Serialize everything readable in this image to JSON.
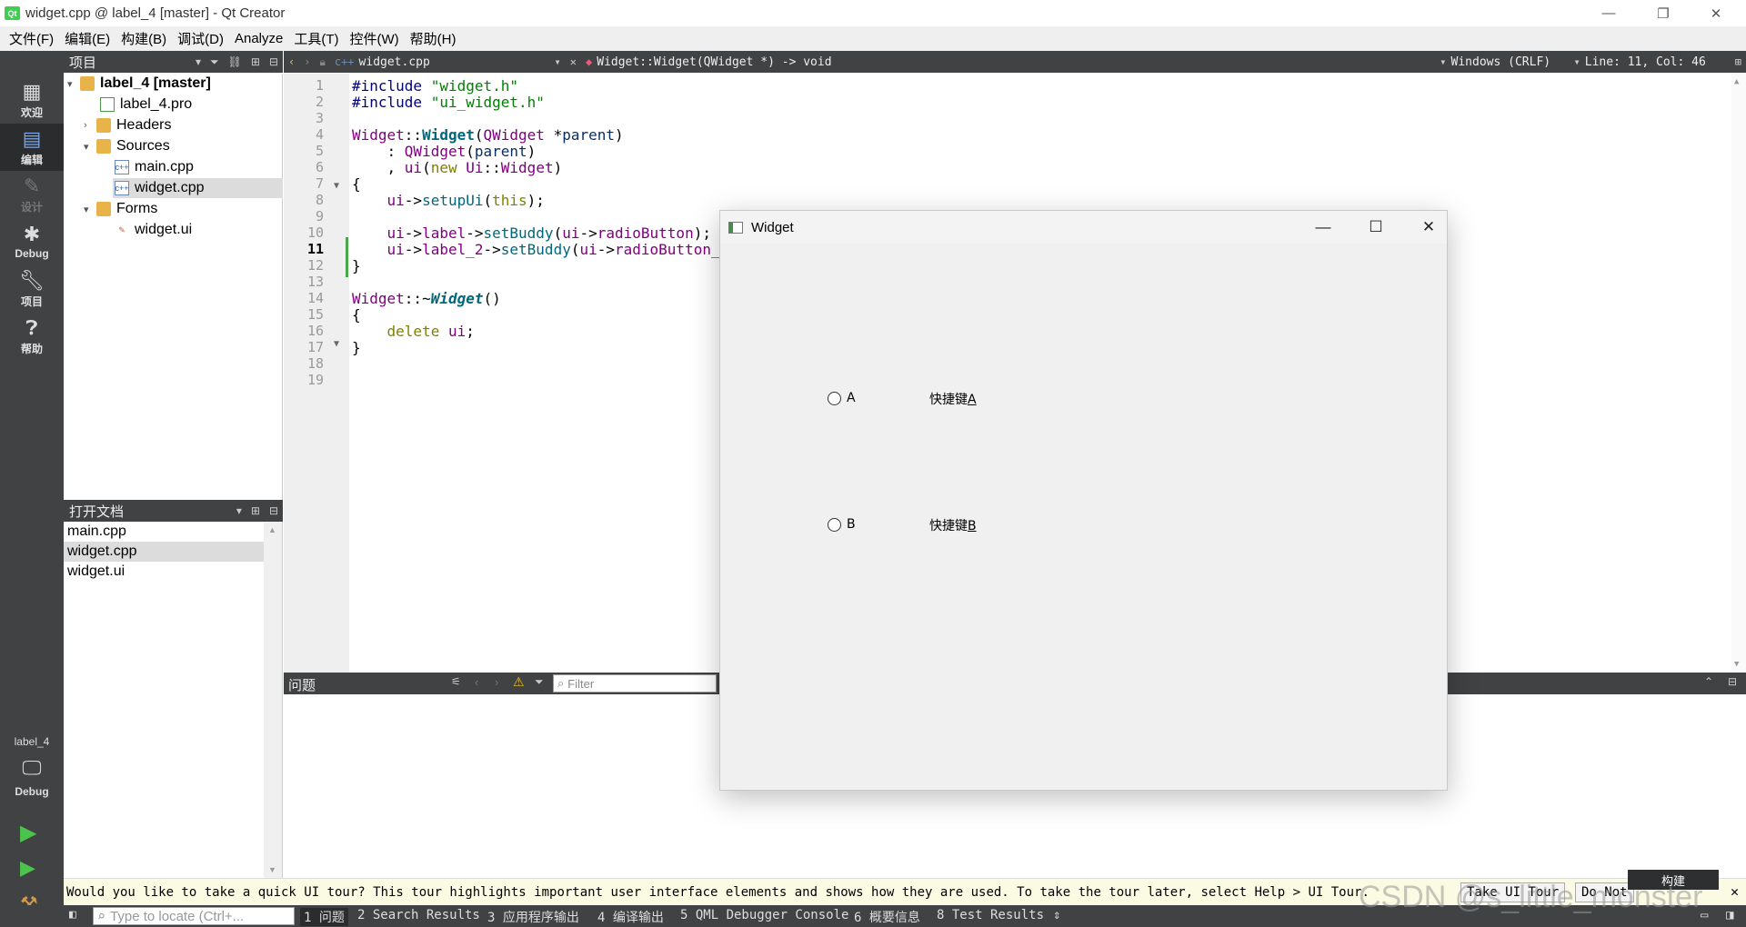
{
  "window": {
    "title": "widget.cpp @ label_4 [master] - Qt Creator"
  },
  "menu": [
    "文件(F)",
    "编辑(E)",
    "构建(B)",
    "调试(D)",
    "Analyze",
    "工具(T)",
    "控件(W)",
    "帮助(H)"
  ],
  "modes": [
    {
      "label": "欢迎",
      "icon": "grid-icon"
    },
    {
      "label": "编辑",
      "icon": "edit-icon"
    },
    {
      "label": "设计",
      "icon": "pencil-icon"
    },
    {
      "label": "Debug",
      "icon": "bug-icon"
    },
    {
      "label": "项目",
      "icon": "wrench-icon"
    },
    {
      "label": "帮助",
      "icon": "help-icon"
    }
  ],
  "kit": {
    "project": "label_4",
    "config": "Debug"
  },
  "project_pane": {
    "title": "项目",
    "tree": [
      {
        "label": "label_4 [master]"
      },
      {
        "label": "label_4.pro"
      },
      {
        "label": "Headers"
      },
      {
        "label": "Sources"
      },
      {
        "label": "main.cpp"
      },
      {
        "label": "widget.cpp"
      },
      {
        "label": "Forms"
      },
      {
        "label": "widget.ui"
      }
    ]
  },
  "open_docs": {
    "title": "打开文档",
    "items": [
      "main.cpp",
      "widget.cpp",
      "widget.ui"
    ]
  },
  "editor_bar": {
    "file": "widget.cpp",
    "symbol": "Widget::Widget(QWidget *) -> void",
    "encoding": "Windows (CRLF)",
    "position": "Line: 11, Col: 46"
  },
  "line_numbers": [
    "1",
    "2",
    "3",
    "4",
    "5",
    "6",
    "7",
    "8",
    "9",
    "10",
    "11",
    "12",
    "13",
    "14",
    "15",
    "16",
    "17",
    "18",
    "19"
  ],
  "issues": {
    "title": "问题",
    "filter_placeholder": "Filter"
  },
  "tour": {
    "message": "Would you like to take a quick UI tour? This tour highlights important user interface elements and shows how they are used. To take the tour later, select Help > UI Tour.",
    "take_button": "Take UI Tour",
    "dismiss_button": "Do Not"
  },
  "status": {
    "locator_placeholder": "Type to locate (Ctrl+...",
    "tabs": [
      "1 问题",
      "2 Search Results",
      "3 应用程序输出",
      "4 编译输出",
      "5 QML Debugger Console",
      "6 概要信息",
      "8 Test Results"
    ]
  },
  "build_tooltip": "构建",
  "widget_window": {
    "title": "Widget",
    "radio_a": "A",
    "radio_b": "B",
    "label_a_prefix": "快捷键",
    "label_a_key": "A",
    "label_b_prefix": "快捷键",
    "label_b_key": "B"
  },
  "watermark": "CSDN @s_little_monster"
}
